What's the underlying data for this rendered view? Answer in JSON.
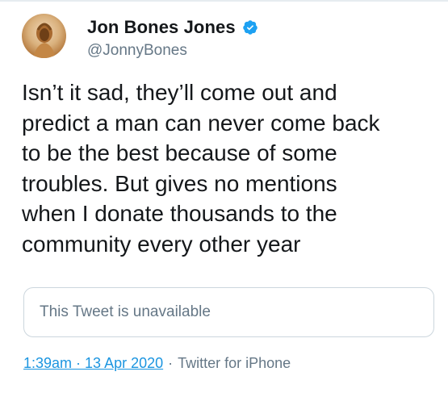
{
  "user": {
    "display_name": "Jon Bones Jones",
    "handle": "@JonnyBones",
    "verified": true,
    "avatar_icon": "avatar-photo",
    "verified_icon": "verified-badge-icon"
  },
  "tweet": {
    "text": "Isn’t it sad, they’ll come out and\npredict a man can never come back\nto be the best because of some\ntroubles. But gives no mentions\nwhen I donate thousands to the\ncommunity every other year",
    "quoted_tweet": "This Tweet is unavailable",
    "timestamp": "1:39am · 13 Apr 2020",
    "separator": "·",
    "source": "Twitter for iPhone"
  },
  "colors": {
    "text": "#14171a",
    "secondary": "#657786",
    "link": "#1b95e0",
    "verified": "#1da1f2",
    "border": "#ccd6dd"
  }
}
